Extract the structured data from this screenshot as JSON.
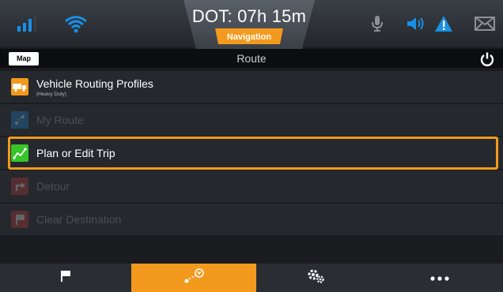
{
  "status": {
    "dot_label": "DOT: 07h 15m",
    "nav_label": "Navigation",
    "icons": [
      "signal-icon",
      "wifi-icon",
      "microphone-icon",
      "speaker-icon",
      "warning-icon",
      "mail-icon"
    ]
  },
  "titlebar": {
    "map_button": "Map",
    "title": "Route",
    "power_icon": "power-icon"
  },
  "menu": [
    {
      "label": "Vehicle Routing Profiles",
      "sub": "(Heavy Duty)",
      "icon": "truck-icon",
      "enabled": true,
      "selected": false
    },
    {
      "label": "My Route",
      "icon": "route-icon",
      "enabled": false,
      "selected": false
    },
    {
      "label": "Plan or Edit Trip",
      "icon": "plan-trip-icon",
      "enabled": true,
      "selected": true
    },
    {
      "label": "Detour",
      "icon": "detour-icon",
      "enabled": false,
      "selected": false
    },
    {
      "label": "Clear Destination",
      "icon": "clear-destination-icon",
      "enabled": false,
      "selected": false
    }
  ],
  "bottom_tabs": [
    {
      "icon": "flag-icon",
      "active": false
    },
    {
      "icon": "route-tab-icon",
      "active": true
    },
    {
      "icon": "settings-icon",
      "active": false
    },
    {
      "icon": "more-icon",
      "active": false
    }
  ],
  "colors": {
    "accent": "#f39a1e",
    "blue": "#1a8fe6",
    "green": "#37c52a",
    "row_bg": "#25292e"
  }
}
